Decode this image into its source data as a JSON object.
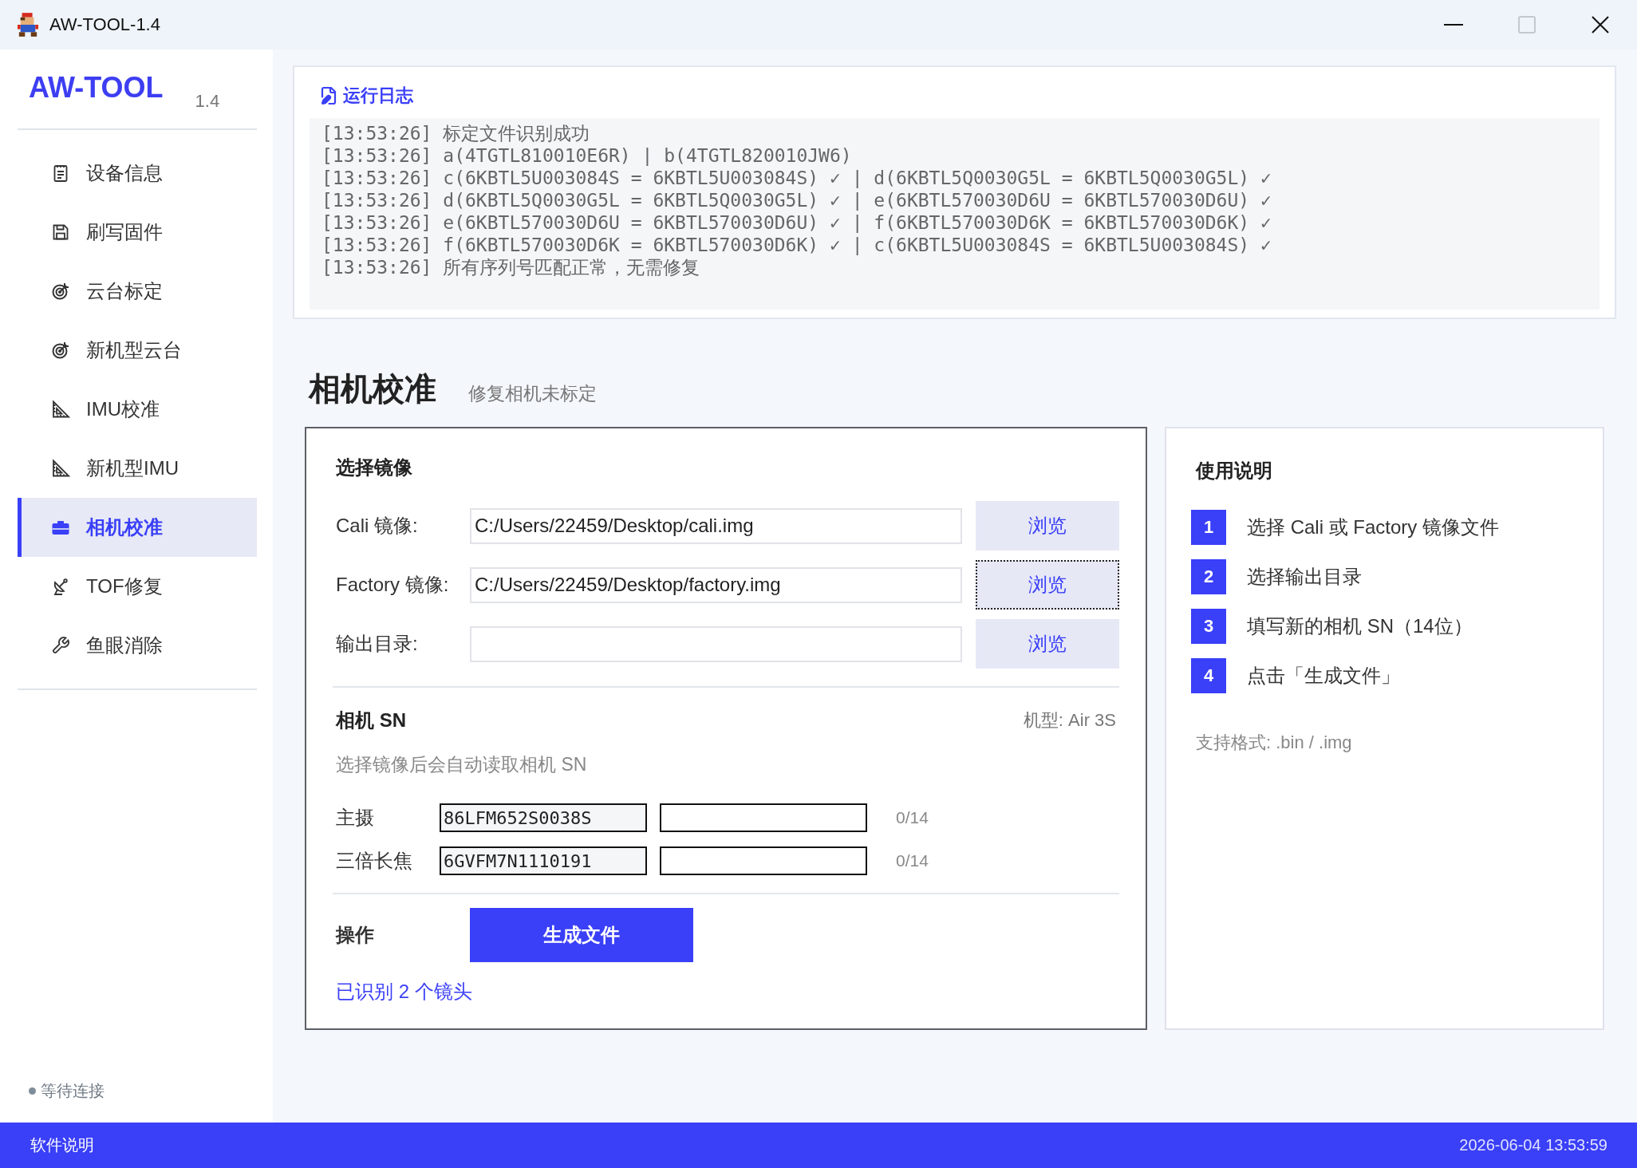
{
  "window": {
    "title": "AW-TOOL-1.4"
  },
  "sidebar": {
    "logo": "AW-TOOL",
    "version": "1.4",
    "items": [
      {
        "label": "设备信息",
        "kind": "device",
        "selected": false
      },
      {
        "label": "刷写固件",
        "kind": "firmware",
        "selected": false
      },
      {
        "label": "云台标定",
        "kind": "gimbal",
        "selected": false
      },
      {
        "label": "新机型云台",
        "kind": "gimbal",
        "selected": false
      },
      {
        "label": "IMU校准",
        "kind": "imu",
        "selected": false
      },
      {
        "label": "新机型IMU",
        "kind": "imu",
        "selected": false
      },
      {
        "label": "相机校准",
        "kind": "camera",
        "selected": true
      },
      {
        "label": "TOF修复",
        "kind": "tof",
        "selected": false
      },
      {
        "label": "鱼眼消除",
        "kind": "fisheye",
        "selected": false
      }
    ],
    "status": {
      "text": "等待连接",
      "connected": false
    }
  },
  "log": {
    "title": "运行日志",
    "lines": [
      "[13:53:26] 标定文件识别成功",
      "[13:53:26] a(4TGTL810010E6R) | b(4TGTL820010JW6)",
      "[13:53:26] c(6KBTL5U003084S = 6KBTL5U003084S) ✓ | d(6KBTL5Q0030G5L = 6KBTL5Q0030G5L) ✓",
      "[13:53:26] d(6KBTL5Q0030G5L = 6KBTL5Q0030G5L) ✓ | e(6KBTL570030D6U = 6KBTL570030D6U) ✓",
      "[13:53:26] e(6KBTL570030D6U = 6KBTL570030D6U) ✓ | f(6KBTL570030D6K = 6KBTL570030D6K) ✓",
      "[13:53:26] f(6KBTL570030D6K = 6KBTL570030D6K) ✓ | c(6KBTL5U003084S = 6KBTL5U003084S) ✓",
      "[13:53:26] 所有序列号匹配正常，无需修复"
    ]
  },
  "page": {
    "title": "相机校准",
    "subtitle": "修复相机未标定"
  },
  "form": {
    "image_section": {
      "title": "选择镜像",
      "rows": [
        {
          "label": "Cali 镜像:",
          "value": "C:/Users/22459/Desktop/cali.img",
          "button": "浏览",
          "focused": false
        },
        {
          "label": "Factory 镜像:",
          "value": "C:/Users/22459/Desktop/factory.img",
          "button": "浏览",
          "focused": true
        },
        {
          "label": "输出目录:",
          "button": "浏览",
          "focused": false
        }
      ]
    },
    "sn_section": {
      "title": "相机 SN",
      "model": "机型: Air 3S",
      "hint": "选择镜像后会自动读取相机 SN",
      "rows": [
        {
          "label": "主摄",
          "current": "86LFM652S0038S",
          "count": "0/14"
        },
        {
          "label": "三倍长焦",
          "current": "6GVFM7N1110191",
          "count": "0/14"
        }
      ]
    },
    "action_section": {
      "title": "操作",
      "button": "生成文件",
      "result": "已识别 2 个镜头"
    }
  },
  "help": {
    "title": "使用说明",
    "steps": [
      {
        "number": "1",
        "text": "选择 Cali 或 Factory 镜像文件"
      },
      {
        "number": "2",
        "text": "选择输出目录"
      },
      {
        "number": "3",
        "text": "填写新的相机 SN（14位）"
      },
      {
        "number": "4",
        "text": "点击「生成文件」"
      }
    ],
    "note": "支持格式: .bin / .img"
  },
  "status_bar": {
    "left": "软件说明",
    "right": "2026-06-04 13:53:59"
  }
}
